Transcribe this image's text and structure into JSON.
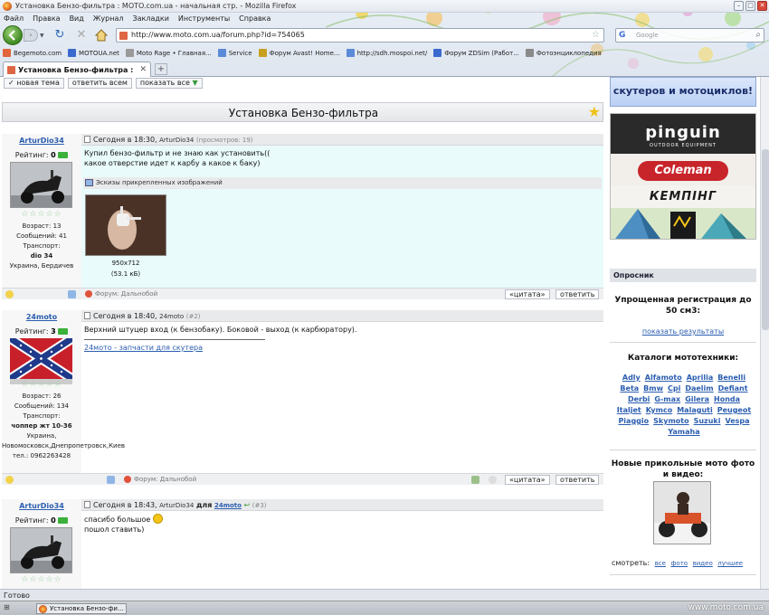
{
  "browser": {
    "window_title": "Установка Бензо-фильтра : MOTO.com.ua - начальная стр. - Mozilla Firefox",
    "menu": [
      "Файл",
      "Правка",
      "Вид",
      "Журнал",
      "Закладки",
      "Инструменты",
      "Справка"
    ],
    "url": "http://www.moto.com.ua/forum.php?id=754065",
    "search_placeholder": "Google",
    "bookmarks": [
      {
        "label": "Begemoto.com",
        "color": "#e0663a"
      },
      {
        "label": "MOTOUA.net",
        "color": "#3a6ad0"
      },
      {
        "label": "Moto Rage • Главная...",
        "color": "#9a9a9a"
      },
      {
        "label": "Service",
        "color": "#5a8ad8"
      },
      {
        "label": "Форум Avast! Home...",
        "color": "#c8a020"
      },
      {
        "label": "http://sdh.mospoi.net/",
        "color": "#5a8ad8"
      },
      {
        "label": "Форум ZDSim (Работ...",
        "color": "#3a6ad0"
      },
      {
        "label": "Фотоэнциклопедия",
        "color": "#8a8a8a"
      }
    ],
    "tab_label": "Установка Бензо-фильтра : MOTO.c...",
    "status": "Готово",
    "taskbar_item": "Установка Бензо-фи...",
    "watermark": "www.moto.com.ua"
  },
  "toolbar": {
    "new_topic": "✓ новая тема",
    "reply_all": "ответить всем",
    "show_all": "показать все"
  },
  "thread": {
    "title": "Установка Бензо-фильтра"
  },
  "posts": [
    {
      "username": "ArturDio34",
      "rating_label": "Рейтинг:",
      "rating": "0",
      "stars": "☆☆☆☆☆",
      "age": "Возраст: 13",
      "messages": "Сообщений: 41",
      "transport_label": "Транспорт:",
      "transport": "dio 34",
      "location": "Украина, Бердичев",
      "date": "Сегодня в 18:30,",
      "author": "ArturDio34",
      "views": "(просмотров: 19)",
      "lines": [
        "Купил бензо-фильтр и не знаю как установить((",
        "какое отверстие идет к карбу а какое к баку)"
      ],
      "attachments_title": "Эскизы прикрепленных изображений",
      "attachment_size": "950x712",
      "attachment_weight": "(53.1 кБ)",
      "forum": "Форум: Дальнобой",
      "quote": "«цитата»",
      "reply": "ответить"
    },
    {
      "username": "24moto",
      "rating_label": "Рейтинг:",
      "rating": "3",
      "stars": "☆☆☆☆☆",
      "age": "Возраст: 26",
      "messages": "Сообщений: 134",
      "transport_label": "Транспорт:",
      "transport": "чоппер жт 10-36",
      "location": "Украина, Новомосковск,Днепропетровск,Киев",
      "phone": "тел.: 0962263428",
      "date": "Сегодня в 18:40,",
      "author": "24moto",
      "num": "(#2)",
      "lines": [
        "Верхний штуцер вход (к бензобаку). Боковой - выход (к карбюратору)."
      ],
      "signature": "24мото - запчасти для скутера",
      "forum": "Форум: Дальнобой",
      "quote": "«цитата»",
      "reply": "ответить"
    },
    {
      "username": "ArturDio34",
      "rating_label": "Рейтинг:",
      "rating": "0",
      "stars": "☆☆☆☆☆",
      "date": "Сегодня в 18:43,",
      "author": "ArturDio34",
      "for": "для",
      "to": "24moto",
      "num": "(#3)",
      "lines": [
        "спасибо большое",
        "пошол ставить)"
      ]
    }
  ],
  "sidebar": {
    "banner": "скутеров и мотоциклов!",
    "ad": {
      "pinguin": "pinguin",
      "pinguin_sub": "OUTDOOR EQUIPMENT",
      "coleman": "Coleman",
      "kemping": "КЕМПІНГ"
    },
    "poll_head": "Опросник",
    "poll_q": "Упрощенная регистрация до 50 см3:",
    "poll_link": "показать результаты",
    "catalog_head": "Каталоги мототехники:",
    "brands": [
      "Adly",
      "Alfamoto",
      "Aprilia",
      "Benelli",
      "Beta",
      "Bmw",
      "Cpi",
      "Daelim",
      "Defiant",
      "Derbi",
      "G-max",
      "Gilera",
      "Honda",
      "Italjet",
      "Kymco",
      "Malaguti",
      "Peugeot",
      "Piaggio",
      "Skymoto",
      "Suzuki",
      "Vespa",
      "Yamaha"
    ],
    "media_head": "Новые прикольные мото фото и видео:",
    "watch_label": "смотреть:",
    "watch_links": [
      "все",
      "фото",
      "видео",
      "лучшее"
    ]
  }
}
